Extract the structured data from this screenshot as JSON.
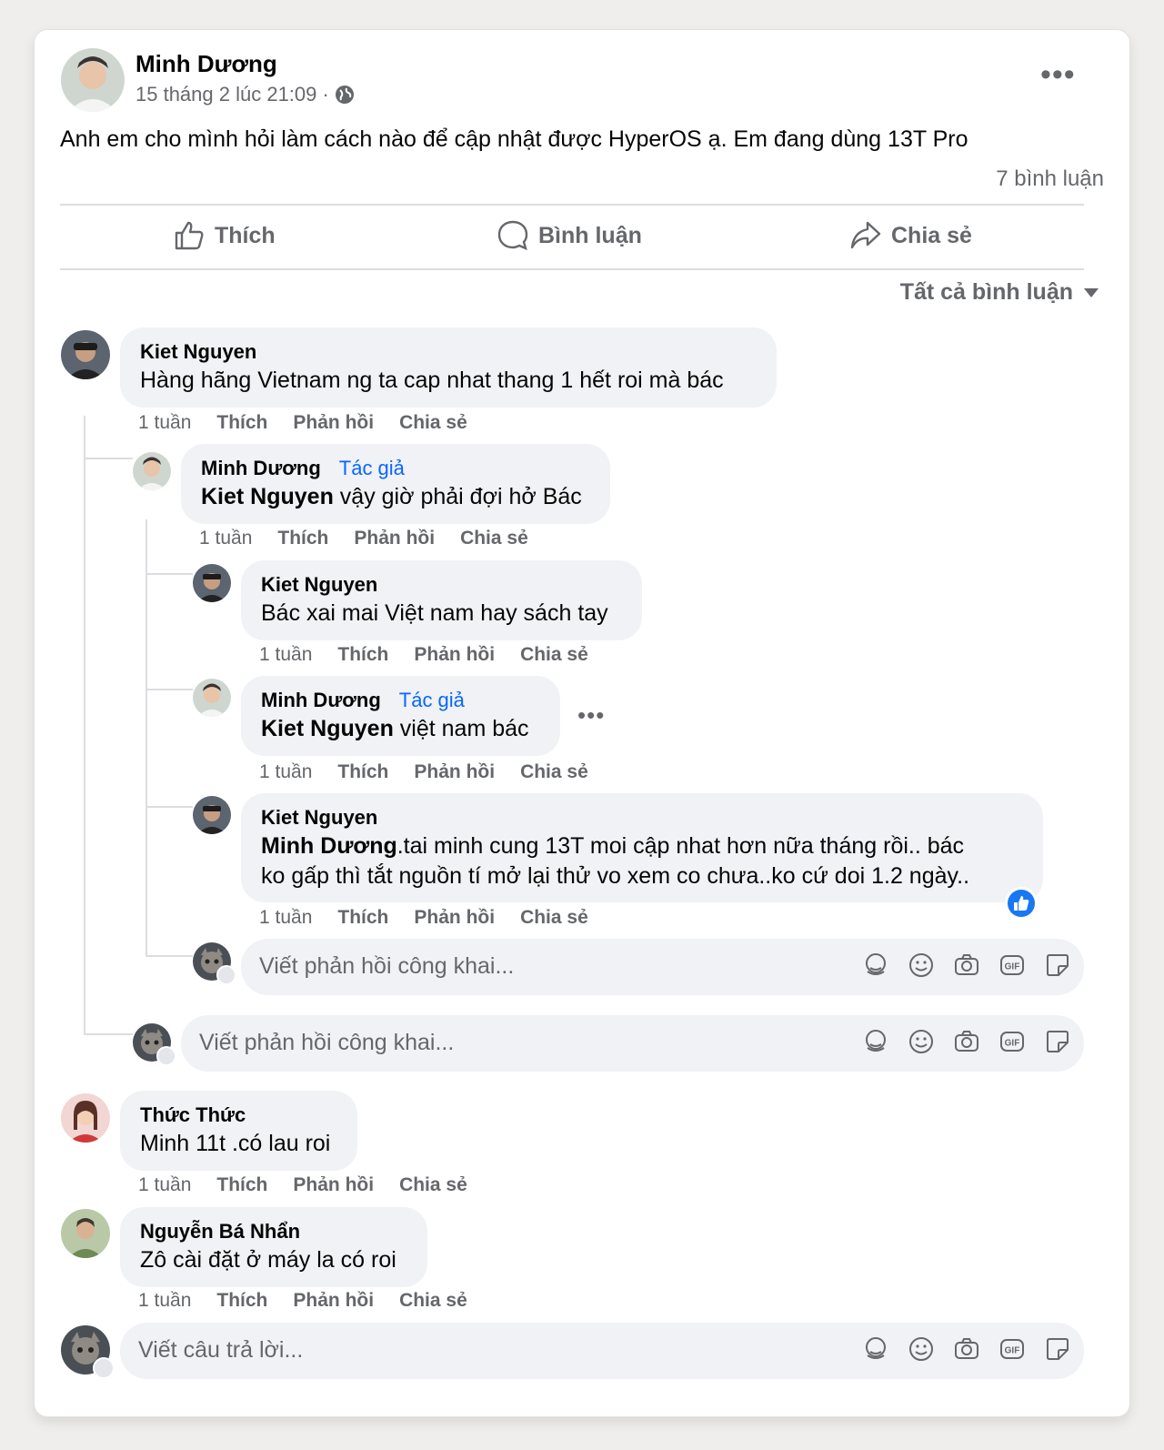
{
  "post": {
    "author": "Minh Dương",
    "timestamp": "15 tháng 2 lúc 21:09 ·",
    "privacy_icon": "globe-icon",
    "text": "Anh em cho mình hỏi làm cách nào để cập nhật được HyperOS ạ. Em đang dùng 13T Pro",
    "comment_count": "7 bình luận",
    "actions": {
      "like": "Thích",
      "comment": "Bình luận",
      "share": "Chia sẻ"
    },
    "sort_label": "Tất cả bình luận"
  },
  "comment_actions": {
    "like": "Thích",
    "reply": "Phản hồi",
    "share": "Chia sẻ"
  },
  "author_badge": "Tác giả",
  "comments": [
    {
      "name": "Kiet Nguyen",
      "text": "Hàng hãng Vietnam ng ta cap nhat thang 1 hết roi mà bác",
      "time": "1 tuần"
    },
    {
      "name": "Minh Dương",
      "mention": "Kiet Nguyen",
      "text": " vậy giờ phải đợi hở Bác",
      "time": "1 tuần"
    },
    {
      "name": "Kiet Nguyen",
      "text": "Bác xai mai Việt nam hay sách tay",
      "time": "1 tuần"
    },
    {
      "name": "Minh Dương",
      "mention": "Kiet Nguyen",
      "text": " việt nam bác",
      "time": "1 tuần"
    },
    {
      "name": "Kiet Nguyen",
      "mention": "Minh Dương",
      "text": ".tai minh cung 13T moi cập nhat hơn nữa tháng rồi.. bác",
      "text2": "ko gấp thì tắt nguồn tí mở lại thử vo xem co chưa..ko cứ doi 1.2 ngày..",
      "time": "1 tuần"
    },
    {
      "name": "Thức Thức",
      "text": "Minh 11t .có lau roi",
      "time": "1 tuần"
    },
    {
      "name": "Nguyễn Bá Nhẩn",
      "text": "Zô cài đặt ở máy la có roi",
      "time": "1 tuần"
    }
  ],
  "reply_placeholder": "Viết phản hồi công khai...",
  "answer_placeholder": "Viết câu trả lời...",
  "colors": {
    "accent": "#0866ff",
    "muted": "#65676b",
    "bubble": "#f0f2f5"
  }
}
